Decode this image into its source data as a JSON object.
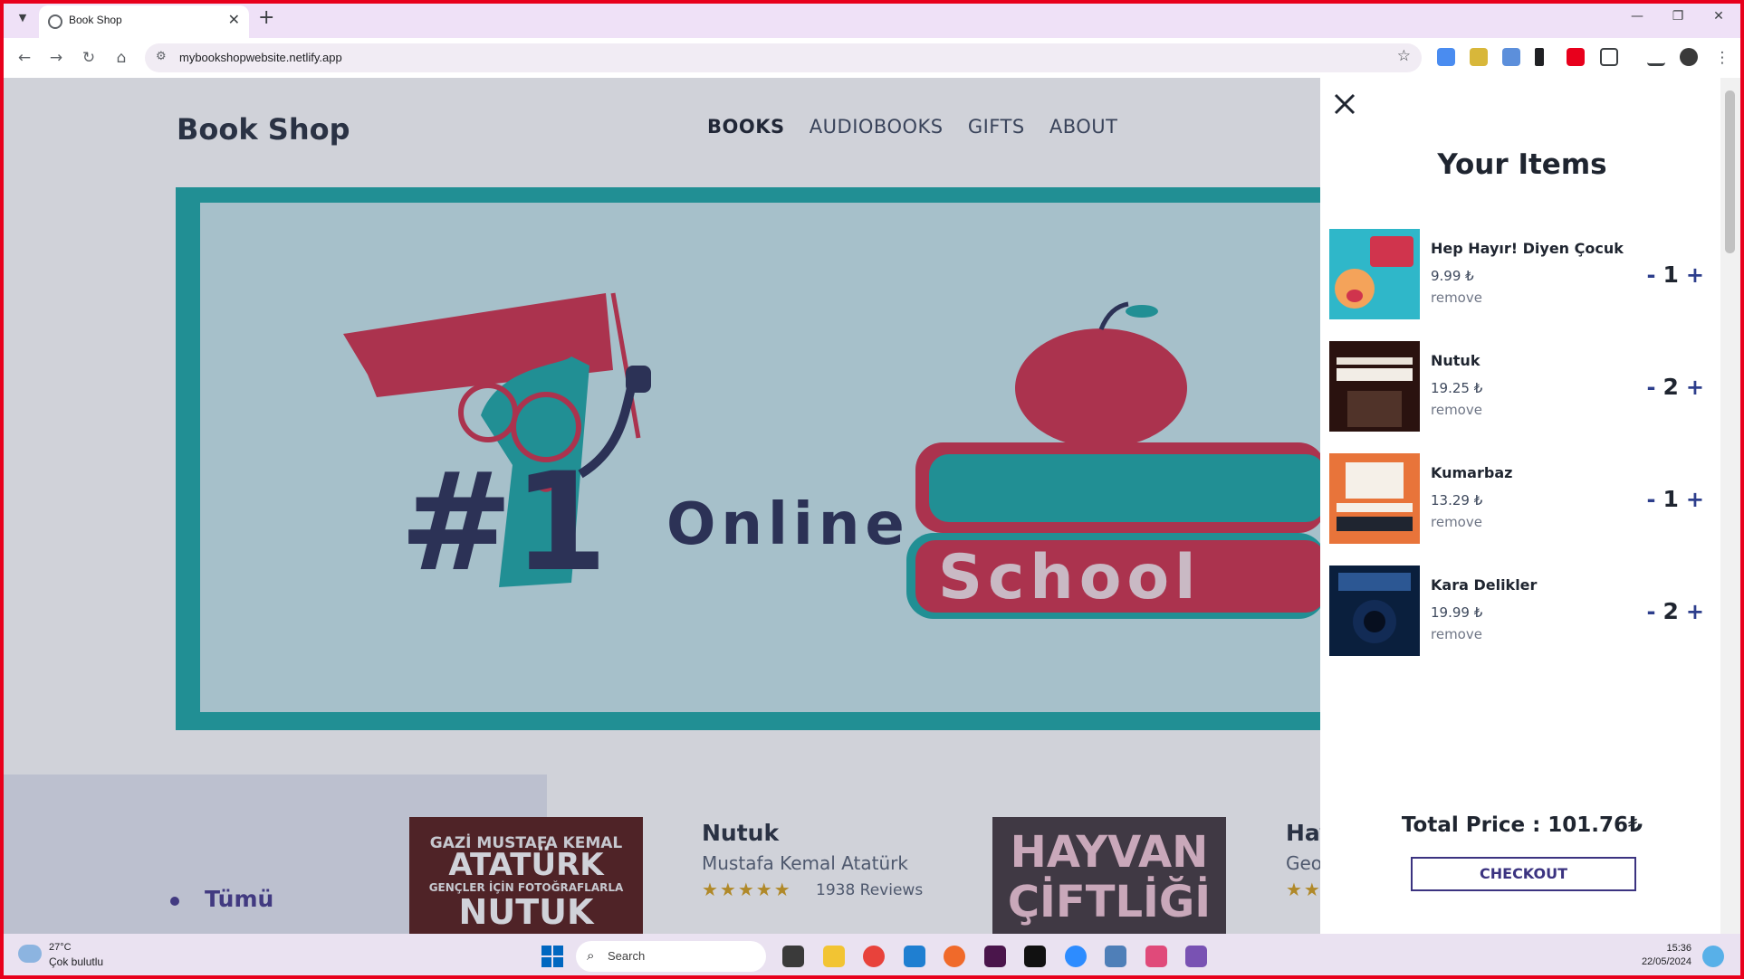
{
  "browser": {
    "tab_title": "Book Shop",
    "url": "mybookshopwebsite.netlify.app"
  },
  "site": {
    "logo": "Book Shop",
    "nav": [
      {
        "label": "BOOKS",
        "active": true
      },
      {
        "label": "AUDIOBOOKS",
        "active": false
      },
      {
        "label": "GIFTS",
        "active": false
      },
      {
        "label": "ABOUT",
        "active": false
      }
    ],
    "banner": {
      "number_text": "#1",
      "word1": "Online",
      "word2": "School"
    },
    "categories": [
      {
        "label": "Tümü"
      }
    ],
    "books": [
      {
        "cover_text": [
          "GAZİ MUSTAFA KEMAL",
          "ATATÜRK",
          "GENÇLER İÇİN FOTOĞRAFLARLA",
          "NUTUK"
        ],
        "title": "Nutuk",
        "author": "Mustafa Kemal Atatürk",
        "stars": "★★★★★",
        "reviews": "1938 Reviews"
      },
      {
        "cover_text": [
          "HAYVAN",
          "ÇİFTLİĞİ"
        ],
        "title": "Hay",
        "author": "Geo",
        "stars": "★★"
      }
    ]
  },
  "cart": {
    "heading": "Your Items",
    "items": [
      {
        "name": "Hep Hayır! Diyen Çocuk",
        "price": "9.99 ₺",
        "remove": "remove",
        "qty": "1",
        "minus": "-",
        "plus": "+",
        "cover_color": "#2fb7c9"
      },
      {
        "name": "Nutuk",
        "price": "19.25 ₺",
        "remove": "remove",
        "qty": "2",
        "minus": "-",
        "plus": "+",
        "cover_color": "#3a1a16"
      },
      {
        "name": "Kumarbaz",
        "price": "13.29 ₺",
        "remove": "remove",
        "qty": "1",
        "minus": "-",
        "plus": "+",
        "cover_color": "#e8743a"
      },
      {
        "name": "Kara Delikler",
        "price": "19.99 ₺",
        "remove": "remove",
        "qty": "2",
        "minus": "-",
        "plus": "+",
        "cover_color": "#0a1f3d"
      }
    ],
    "total": "Total Price : 101.76₺",
    "checkout": "CHECKOUT"
  },
  "taskbar": {
    "temperature": "27°C",
    "weather": "Çok bulutlu",
    "search": "Search",
    "time": "15:36",
    "date": "22/05/2024"
  },
  "colors": {
    "accent": "#2d3e8c",
    "teal": "#1fa9a7",
    "crimson": "#d0344d",
    "frame": "#e8001c"
  }
}
